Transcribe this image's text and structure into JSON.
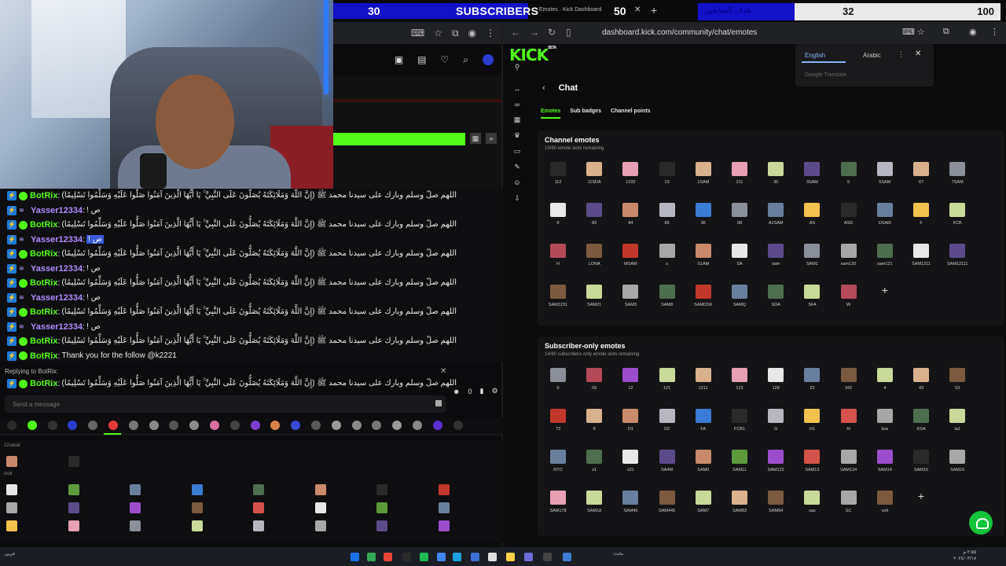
{
  "overlay": {
    "subs_count": "30",
    "subs_label": "SUBSCRIBERS",
    "subs_goal": "50",
    "subs_fraction": 0.6,
    "tab_text": "Emotes · Kick Dashboard",
    "goal_arabic": "هدف المتابعين",
    "goal_current": "32",
    "goal_max": "100",
    "goal_fraction": 0.32
  },
  "chat": {
    "messages": [
      {
        "user": "BotRix",
        "type": "bot",
        "text": "اللهم صلّ وسلم وبارك على سيدنا محمد ﷺ (إِنَّ اللَّهَ وَمَلَائِكَتَهُ يُصَلُّونَ عَلَى النَّبِيِّ ۚ يَا أَيُّهَا الَّذِينَ آمَنُوا صَلُّوا عَلَيْهِ وَسَلِّمُوا تَسْلِيمًا)"
      },
      {
        "user": "Yasser12334",
        "type": "user",
        "text": "! ص"
      },
      {
        "user": "BotRix",
        "type": "bot",
        "text": "اللهم صلّ وسلم وبارك على سيدنا محمد ﷺ (إِنَّ اللَّهَ وَمَلَائِكَتَهُ يُصَلُّونَ عَلَى النَّبِيِّ ۚ يَا أَيُّهَا الَّذِينَ آمَنُوا صَلُّوا عَلَيْهِ وَسَلِّمُوا تَسْلِيمًا)"
      },
      {
        "user": "Yasser12334",
        "type": "user",
        "text": "! ص",
        "highlight": true
      },
      {
        "user": "BotRix",
        "type": "bot",
        "text": "اللهم صلّ وسلم وبارك على سيدنا محمد ﷺ (إِنَّ اللَّهَ وَمَلَائِكَتَهُ يُصَلُّونَ عَلَى النَّبِيِّ ۚ يَا أَيُّهَا الَّذِينَ آمَنُوا صَلُّوا عَلَيْهِ وَسَلِّمُوا تَسْلِيمًا)"
      },
      {
        "user": "Yasser12334",
        "type": "user",
        "text": "! ص"
      },
      {
        "user": "BotRix",
        "type": "bot",
        "text": "اللهم صلّ وسلم وبارك على سيدنا محمد ﷺ (إِنَّ اللَّهَ وَمَلَائِكَتَهُ يُصَلُّونَ عَلَى النَّبِيِّ ۚ يَا أَيُّهَا الَّذِينَ آمَنُوا صَلُّوا عَلَيْهِ وَسَلِّمُوا تَسْلِيمًا)"
      },
      {
        "user": "Yasser12334",
        "type": "user",
        "text": "! ص"
      },
      {
        "user": "BotRix",
        "type": "bot",
        "text": "اللهم صلّ وسلم وبارك على سيدنا محمد ﷺ (إِنَّ اللَّهَ وَمَلَائِكَتَهُ يُصَلُّونَ عَلَى النَّبِيِّ ۚ يَا أَيُّهَا الَّذِينَ آمَنُوا صَلُّوا عَلَيْهِ وَسَلِّمُوا تَسْلِيمًا)"
      },
      {
        "user": "Yasser12334",
        "type": "user",
        "text": "! ص"
      },
      {
        "user": "BotRix",
        "type": "bot",
        "text": "اللهم صلّ وسلم وبارك على سيدنا محمد ﷺ (إِنَّ اللَّهَ وَمَلَائِكَتَهُ يُصَلُّونَ عَلَى النَّبِيِّ ۚ يَا أَيُّهَا الَّذِينَ آمَنُوا صَلُّوا عَلَيْهِ وَسَلِّمُوا تَسْلِيمًا)"
      },
      {
        "user": "BotRix",
        "type": "bot",
        "text": "Thank you for the follow @k2221"
      }
    ],
    "reply_label": "Replying to BotRix:",
    "reply_user": "BotRix",
    "reply_text": "اللهم صلّ وسلم وبارك على سيدنا محمد ﷺ (إِنَّ اللَّهَ وَمَلَائِكَتَهُ يُصَلُّونَ عَلَى النَّبِيِّ ۚ يَا أَيُّهَا الَّذِينَ آمَنُوا صَلُّوا عَلَيْهِ وَسَلِّمُوا تَسْلِيمًا)",
    "input_placeholder": "Send a message",
    "viewer_count": "0",
    "picker_label_1": "22rahaf",
    "picker_label_2": "ivoit"
  },
  "kick": {
    "url": "dashboard.kick.com/community/chat/emotes",
    "logo": "KICK",
    "logo_badge": "BETA",
    "page_title": "Chat",
    "tabs": [
      "Emotes",
      "Sub badges",
      "Channel points"
    ],
    "translate": {
      "english": "English",
      "arabic": "Arabic",
      "footer": "Google Translate"
    },
    "channel_section": {
      "title": "Channel emotes",
      "subtitle": "15/60 emote slots remaining",
      "emotes": [
        "112",
        "11SDA",
        "1232",
        "13",
        "1SAM",
        "211",
        "35",
        "3SAM",
        "5",
        "5SAM",
        "67",
        "7SAM",
        "8",
        "83",
        "84",
        "86",
        "96",
        "98",
        "A1SAM",
        "AS",
        "ASD",
        "DSAM",
        "F",
        "FCB",
        "H",
        "LONA",
        "MSAM",
        "s",
        "S1AM",
        "SA",
        "sam",
        "SAM1",
        "sam120",
        "sam121",
        "SAM1211",
        "SAM12111",
        "SAM1231",
        "SAM21",
        "SAM3",
        "SAM8",
        "SAMDSK",
        "SAMQ",
        "SDA",
        "SFA",
        "W"
      ]
    },
    "sub_section": {
      "title": "Subscriber-only emotes",
      "subtitle": "14/60 subscribers only emote slots remaining",
      "emotes": [
        "0",
        "09",
        "12",
        "121",
        "1211",
        "123",
        "128",
        "23",
        "342",
        "4",
        "43",
        "53",
        "73",
        "8",
        "D1",
        "D2",
        "FA",
        "FCB1",
        "G",
        "H1",
        "hl",
        "ksa",
        "KSA",
        "la1",
        "RTO",
        "s1",
        "s21",
        "SA4M",
        "SAM0",
        "SAM11",
        "SAM122",
        "SAM13",
        "SAM134",
        "SAM14",
        "SAM15",
        "SAM16",
        "SAM178",
        "SAM18",
        "SAM40",
        "SAM445",
        "SAM7",
        "SAM83",
        "SAM94",
        "sas",
        "SC",
        "volt"
      ]
    }
  },
  "taskbar": {
    "time": "٢:٥٥ م",
    "date": "٢٠٢٤/٠٣/١٧",
    "search": "بحث",
    "lang": "عربي"
  }
}
